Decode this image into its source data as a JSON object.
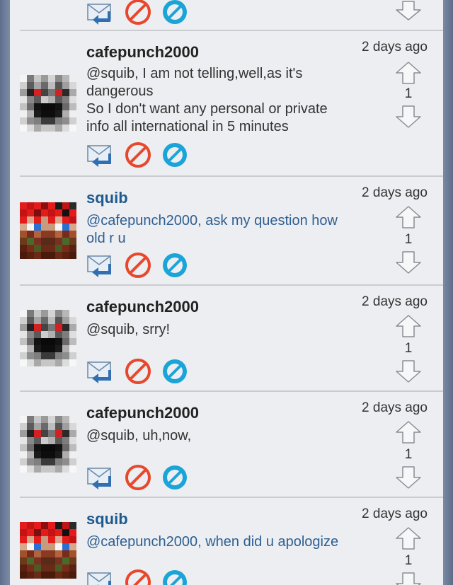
{
  "icons": {
    "reply": "reply-mail-icon",
    "flag": "flag-no-icon",
    "block": "block-icon",
    "upvote": "up-arrow-icon",
    "downvote": "down-arrow-icon"
  },
  "colors": {
    "background": "#eceef1",
    "username_dark": "#222222",
    "username_blue": "#1e5a8f",
    "reply_text_blue": "#2d5f92",
    "flag_red": "#e8472c",
    "block_blue": "#1ba4d8"
  },
  "comments": [
    {
      "author": "cafepunch2000",
      "time": "2 days ago",
      "text": "@squib, I am not telling,well,as it's\ndangerous\nSo I don't want any personal or private\ninfo all international in 5 minutes",
      "votes": "1"
    },
    {
      "author": "squib",
      "time": "2 days ago",
      "text": "@cafepunch2000, ask my question how\nold r u",
      "votes": "1"
    },
    {
      "author": "cafepunch2000",
      "time": "2 days ago",
      "text": "@squib, srry!",
      "votes": "1"
    },
    {
      "author": "cafepunch2000",
      "time": "2 days ago",
      "text": "@squib, uh,now,",
      "votes": "1"
    },
    {
      "author": "squib",
      "time": "2 days ago",
      "text": "@cafepunch2000, when did u apologize",
      "votes": "1"
    }
  ]
}
